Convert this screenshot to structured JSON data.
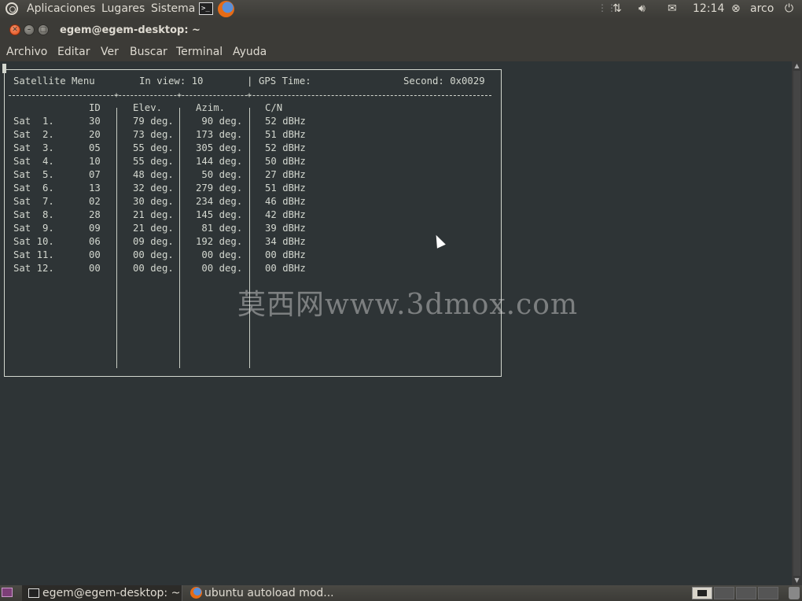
{
  "top_panel": {
    "menus": [
      "Aplicaciones",
      "Lugares",
      "Sistema"
    ],
    "clock": "12:14",
    "user": "arco"
  },
  "window": {
    "title": "egem@egem-desktop: ~",
    "menu": [
      "Archivo",
      "Editar",
      "Ver",
      "Buscar",
      "Terminal",
      "Ayuda"
    ]
  },
  "terminal": {
    "header": {
      "menu_title": "Satellite Menu",
      "in_view_label": "In view: 10",
      "gps_time_label": "GPS Time:",
      "second_label": "Second: 0x0029"
    },
    "columns": {
      "id": "ID",
      "elev": "Elev.",
      "azim": "Azim.",
      "cn": "C/N"
    },
    "rows": [
      {
        "name": "Sat  1.",
        "id": "30",
        "elev": "79 deg.",
        "azim": " 90 deg.",
        "cn": "52 dBHz"
      },
      {
        "name": "Sat  2.",
        "id": "20",
        "elev": "73 deg.",
        "azim": "173 deg.",
        "cn": "51 dBHz"
      },
      {
        "name": "Sat  3.",
        "id": "05",
        "elev": "55 deg.",
        "azim": "305 deg.",
        "cn": "52 dBHz"
      },
      {
        "name": "Sat  4.",
        "id": "10",
        "elev": "55 deg.",
        "azim": "144 deg.",
        "cn": "50 dBHz"
      },
      {
        "name": "Sat  5.",
        "id": "07",
        "elev": "48 deg.",
        "azim": " 50 deg.",
        "cn": "27 dBHz"
      },
      {
        "name": "Sat  6.",
        "id": "13",
        "elev": "32 deg.",
        "azim": "279 deg.",
        "cn": "51 dBHz"
      },
      {
        "name": "Sat  7.",
        "id": "02",
        "elev": "30 deg.",
        "azim": "234 deg.",
        "cn": "46 dBHz"
      },
      {
        "name": "Sat  8.",
        "id": "28",
        "elev": "21 deg.",
        "azim": "145 deg.",
        "cn": "42 dBHz"
      },
      {
        "name": "Sat  9.",
        "id": "09",
        "elev": "21 deg.",
        "azim": " 81 deg.",
        "cn": "39 dBHz"
      },
      {
        "name": "Sat 10.",
        "id": "06",
        "elev": "09 deg.",
        "azim": "192 deg.",
        "cn": "34 dBHz"
      },
      {
        "name": "Sat 11.",
        "id": "00",
        "elev": "00 deg.",
        "azim": " 00 deg.",
        "cn": "00 dBHz"
      },
      {
        "name": "Sat 12.",
        "id": "00",
        "elev": "00 deg.",
        "azim": " 00 deg.",
        "cn": "00 dBHz"
      }
    ],
    "watermark": "莫西网www.3dmox.com"
  },
  "taskbar": {
    "tasks": [
      "egem@egem-desktop: ~",
      "ubuntu autoload mod..."
    ]
  }
}
